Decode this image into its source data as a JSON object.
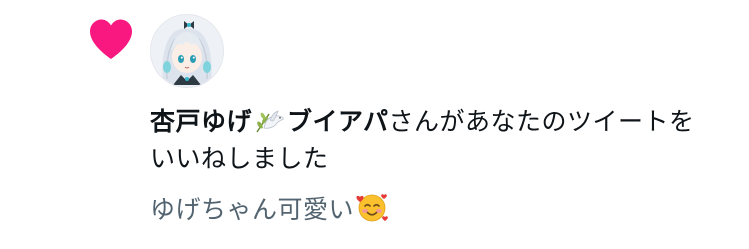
{
  "notification": {
    "type": "like",
    "accent_color": "#f91880",
    "icon": "heart-icon",
    "avatar_icon": "avatar-image",
    "username": "杏戸ゆげ",
    "username_emoji": "dove-olive-branch-emoji",
    "username_suffix": "ブイアパ",
    "action_text": "さんがあなたのツイートをいいねしました",
    "tweet_preview": "ゆげちゃん可愛い",
    "tweet_emoji": "smiling-face-with-hearts-emoji"
  }
}
